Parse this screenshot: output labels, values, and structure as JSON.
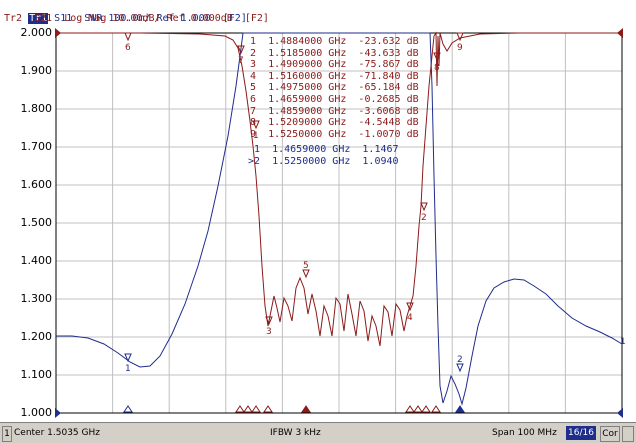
{
  "header": {
    "tr1": {
      "badge": "Tr1",
      "text": " S11  SWR 100.0m/ Ref 1.000  [F2]"
    },
    "tr2": {
      "text": "Tr2  S21  Log Mag 10.00dB/ Ref 0.000dB  [F2]"
    }
  },
  "y_axis": {
    "labels": [
      "2.000",
      "1.900",
      "1.800",
      "1.700",
      "1.600",
      "1.500",
      "1.400",
      "1.300",
      "1.200",
      "1.100",
      "1.000"
    ]
  },
  "marker_table_s21": [
    {
      "num": "1",
      "freq": "1.4884000 GHz",
      "val": "-23.632 dB"
    },
    {
      "num": "2",
      "freq": "1.5185000 GHz",
      "val": "-43.633 dB"
    },
    {
      "num": "3",
      "freq": "1.4909000 GHz",
      "val": "-75.867 dB"
    },
    {
      "num": "4",
      "freq": "1.5160000 GHz",
      "val": "-71.840 dB"
    },
    {
      "num": "5",
      "freq": "1.4975000 GHz",
      "val": "-65.184 dB"
    },
    {
      "num": "6",
      "freq": "1.4659000 GHz",
      "val": "-0.2685 dB"
    },
    {
      "num": "7",
      "freq": "1.4859000 GHz",
      "val": "-3.6068 dB"
    },
    {
      "num": "8",
      "freq": "1.5209000 GHz",
      "val": "-4.5448 dB"
    },
    {
      "num": "9",
      "freq": "1.5250000 GHz",
      "val": "-1.0070 dB"
    }
  ],
  "marker_table_s11": [
    {
      "num": "1",
      "freq": "1.4659000 GHz",
      "val": "1.1467"
    },
    {
      "num": ">2",
      "freq": "1.5250000 GHz",
      "val": "1.0940"
    }
  ],
  "status_bar": {
    "channel": "1",
    "center": "Center 1.5035 GHz",
    "ifbw": "IFBW 3 kHz",
    "span": "Span 100 MHz",
    "count": "16/16",
    "correction": "Cor"
  },
  "colors": {
    "s11": "#1f2d8c",
    "s21": "#8b1a1a",
    "grid": "#c0c0c0"
  },
  "chart_data": {
    "type": "line",
    "xlabel": "",
    "ylabel": "",
    "x_range_ghz": [
      1.4535,
      1.5535
    ],
    "ylim": [
      1.0,
      2.0
    ],
    "grid": true,
    "series": [
      {
        "name": "Tr1 S11 SWR",
        "marker_values": [
          1.1467,
          1.094
        ]
      },
      {
        "name": "Tr2 S21 Log Mag",
        "marker_values_db": [
          -23.632,
          -43.633,
          -75.867,
          -71.84,
          -65.184,
          -0.2685,
          -3.6068,
          -4.5448,
          -1.007
        ]
      }
    ]
  }
}
